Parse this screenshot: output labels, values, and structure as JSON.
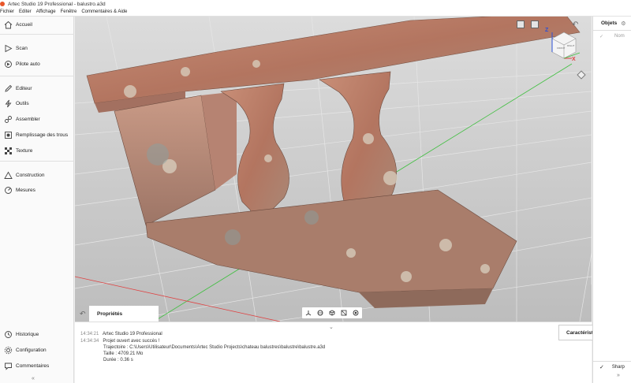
{
  "window": {
    "title": "Artec Studio 19 Professional - balustro.a3d"
  },
  "menu": [
    "Fichier",
    "Editer",
    "Affichage",
    "Fenêtre",
    "Commentaires & Aide"
  ],
  "sidebar": {
    "items": [
      {
        "label": "Accueil",
        "icon": "home-icon"
      },
      {
        "label": "Scan",
        "icon": "play-icon"
      },
      {
        "label": "Pilote auto",
        "icon": "autopilot-icon"
      },
      {
        "label": "Editeur",
        "icon": "pencil-icon"
      },
      {
        "label": "Outils",
        "icon": "lightning-icon"
      },
      {
        "label": "Assembler",
        "icon": "link-icon"
      },
      {
        "label": "Remplissage des trous",
        "icon": "hole-fill-icon"
      },
      {
        "label": "Texture",
        "icon": "texture-icon"
      },
      {
        "label": "Construction",
        "icon": "triangle-icon"
      },
      {
        "label": "Mesures",
        "icon": "ruler-icon"
      }
    ],
    "bottom_items": [
      {
        "label": "Historique",
        "icon": "history-icon"
      },
      {
        "label": "Configuration",
        "icon": "gear-icon"
      },
      {
        "label": "Commentaires",
        "icon": "comment-icon"
      }
    ],
    "collapse_glyph": "«"
  },
  "viewport": {
    "gizmo": {
      "z": "Z",
      "x": "X",
      "front": "FRONT",
      "side": "RIGHT"
    },
    "properties_label": "Propriétés"
  },
  "console": {
    "lines": [
      {
        "time": "14:34:21",
        "text": "Artec Studio 19 Professional"
      },
      {
        "time": "14:34:34",
        "text": "Projet ouvert avec succès !"
      },
      {
        "time": "",
        "text": "Trajectoire : C:\\Users\\Utilisateur\\Documents\\Artec Studio Projects\\chateau balustres\\balustre\\balustre.a3d"
      },
      {
        "time": "",
        "text": "Taille : 4709.21 Mo"
      },
      {
        "time": "",
        "text": "Durée : 0.36 s"
      }
    ]
  },
  "right_panel": {
    "title": "Objets",
    "column_name": "Nom",
    "bottom_label": "Sharp"
  },
  "characteristics": {
    "title": "Caractéristiques"
  },
  "colors": {
    "accent": "#e8562a",
    "grid_green": "#3fbf3f",
    "grid_red": "#e04040",
    "gizmo_blue": "#2a4fd6"
  }
}
